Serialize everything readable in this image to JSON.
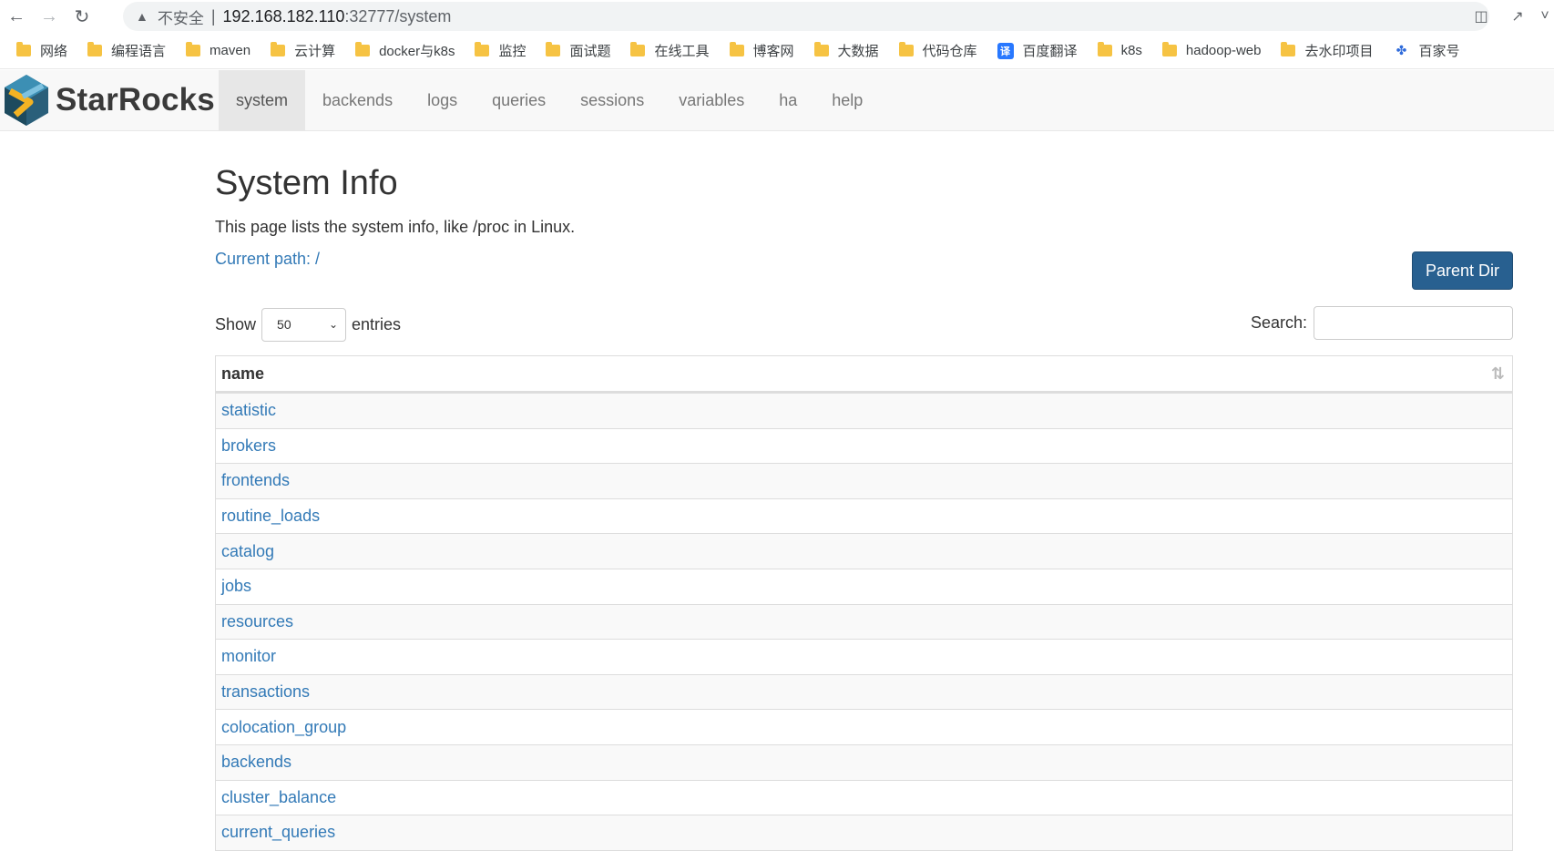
{
  "browser": {
    "url_warning": "不安全",
    "url_host": "192.168.182.110",
    "url_path": ":32777/system",
    "bookmarks": [
      {
        "label": "网络",
        "icon": "folder-icon"
      },
      {
        "label": "编程语言",
        "icon": "folder-icon"
      },
      {
        "label": "maven",
        "icon": "folder-icon"
      },
      {
        "label": "云计算",
        "icon": "folder-icon"
      },
      {
        "label": "docker与k8s",
        "icon": "folder-icon"
      },
      {
        "label": "监控",
        "icon": "folder-icon"
      },
      {
        "label": "面试题",
        "icon": "folder-icon"
      },
      {
        "label": "在线工具",
        "icon": "folder-icon"
      },
      {
        "label": "博客网",
        "icon": "folder-icon"
      },
      {
        "label": "大数据",
        "icon": "folder-icon"
      },
      {
        "label": "代码仓库",
        "icon": "folder-icon"
      },
      {
        "label": "百度翻译",
        "icon": "translate-icon"
      },
      {
        "label": "k8s",
        "icon": "folder-icon"
      },
      {
        "label": "hadoop-web",
        "icon": "folder-icon"
      },
      {
        "label": "去水印项目",
        "icon": "folder-icon"
      },
      {
        "label": "百家号",
        "icon": "baidu-paw-icon"
      }
    ]
  },
  "app": {
    "brand": "StarRocks",
    "nav": [
      "system",
      "backends",
      "logs",
      "queries",
      "sessions",
      "variables",
      "ha",
      "help"
    ],
    "active_nav": "system",
    "colors": {
      "link": "#337ab7",
      "primary_button": "#286090",
      "nav_bg": "#f8f8f8"
    }
  },
  "page": {
    "title": "System Info",
    "description": "This page lists the system info, like /proc in Linux.",
    "current_path": "Current path: /",
    "parent_button": "Parent Dir",
    "show_label": "Show",
    "entries_value": "50",
    "entries_label": "entries",
    "search_label": "Search:",
    "search_value": ""
  },
  "table": {
    "header": "name",
    "rows": [
      "statistic",
      "brokers",
      "frontends",
      "routine_loads",
      "catalog",
      "jobs",
      "resources",
      "monitor",
      "transactions",
      "colocation_group",
      "backends",
      "cluster_balance",
      "current_queries"
    ]
  }
}
